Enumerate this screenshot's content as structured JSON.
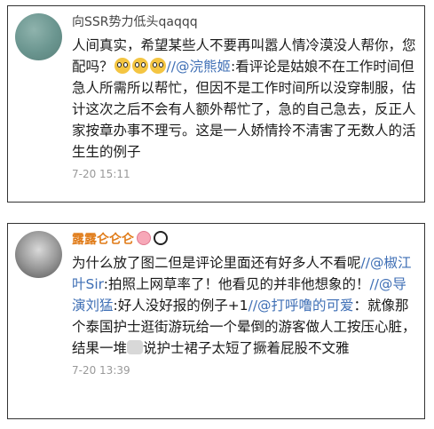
{
  "comments": [
    {
      "username": "向SSR势力低头qaqqq",
      "avatar": "teal-avatar",
      "line1": "人间真实，希望某些人不要再叫嚣人情冷漠没人帮你，您配吗？",
      "mention": "//@浣熊姬",
      "line2": ":看评论是姑娘不在工作时间但急人所需所以帮忙，但因不是工作时间所以没穿制服，估计这次之后不会有人额外帮忙了，急的自己急去，反正人家按章办事不理亏。这是一人娇情拎不清害了无数人的活生生的例子",
      "time": "7-20 15:11"
    },
    {
      "username": "露露仑仑仑",
      "avatar": "grayscale-portrait-avatar",
      "seg1": "为什么放了图二但是评论里面还有好多人不看呢",
      "m1": "//@椒江叶Sir",
      "seg2": ":拍照上网草率了！他看见的并非他想象的！",
      "m2": "//@导演刘猛",
      "seg3": ":好人没好报的例子+1",
      "m3": "//@打呼噜的可爱",
      "seg4": "：就像那个泰国护士逛街游玩给一个晕倒的游客做人工按压心脏，结果一堆",
      "seg5": "说护士裙子太短了撅着屁股不文雅",
      "time": "7-20 13:39"
    }
  ]
}
